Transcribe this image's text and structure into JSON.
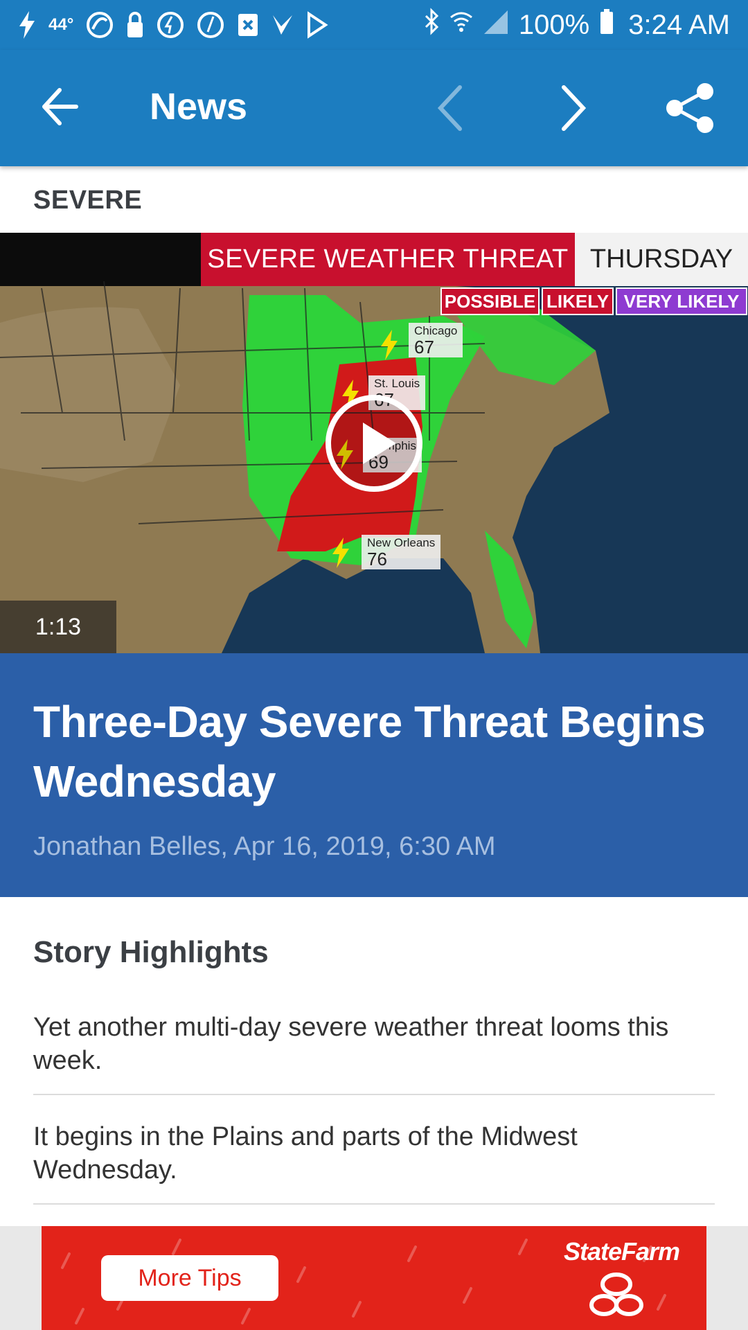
{
  "status_bar": {
    "temperature": "44°",
    "battery_percent": "100%",
    "time": "3:24 AM",
    "left_icons": [
      "flash-icon",
      "hurricane-icon",
      "lock-icon",
      "clock-icon",
      "clock-icon",
      "x-box-icon",
      "check-icon",
      "play-store-icon"
    ],
    "right_icons": [
      "bluetooth-icon",
      "wifi-icon",
      "signal-icon",
      "battery-icon"
    ]
  },
  "app_bar": {
    "title": "News",
    "back_icon": "arrow-left-icon",
    "prev_icon": "chevron-left-icon",
    "next_icon": "chevron-right-icon",
    "share_icon": "share-icon",
    "color": "#1c7dc0"
  },
  "article": {
    "category": "SEVERE",
    "video": {
      "banner_title": "SEVERE WEATHER THREAT",
      "banner_day": "THURSDAY",
      "legend": [
        "POSSIBLE",
        "LIKELY",
        "VERY LIKELY"
      ],
      "cities": [
        {
          "name": "Chicago",
          "temp": "67"
        },
        {
          "name": "St. Louis",
          "temp": "67"
        },
        {
          "name": "Memphis",
          "temp": "69"
        },
        {
          "name": "New Orleans",
          "temp": "76"
        }
      ],
      "duration": "1:13"
    },
    "headline": "Three-Day Severe Threat Begins Wednesday",
    "byline": "Jonathan Belles, Apr 16, 2019, 6:30 AM",
    "headline_bg": "#2b5fa8"
  },
  "highlights": {
    "title": "Story Highlights",
    "items": [
      "Yet another multi-day severe weather threat looms this week.",
      "It begins in the Plains and parts of the Midwest Wednesday."
    ]
  },
  "ad": {
    "button_label": "More Tips",
    "brand": "StateFarm",
    "bg_color": "#e2231a"
  }
}
